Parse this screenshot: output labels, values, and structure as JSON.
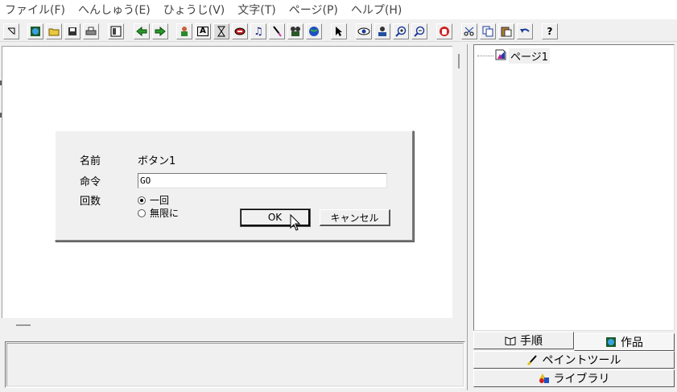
{
  "menu": [
    "ファイル(F)",
    "へんしゅう(E)",
    "ひょうじ(V)",
    "文字(T)",
    "ページ(P)",
    "ヘルプ(H)"
  ],
  "toolbar": {
    "help_label": "?",
    "text_tool_label": "A",
    "icons": [
      "select-arrow-icon",
      "new-page-icon",
      "open-folder-icon",
      "save-icon",
      "print-icon",
      "layout-icon",
      "back-arrow-icon",
      "forward-arrow-icon",
      "actor-icon",
      "text-tool-icon",
      "hourglass-icon",
      "button-tool-icon",
      "music-icon",
      "brush-icon",
      "movie-icon",
      "globe-icon",
      "pointer-icon",
      "eye-icon",
      "stamp-icon",
      "zoom-in-icon",
      "zoom-out-icon",
      "stop-hand-icon",
      "cut-icon",
      "copy-icon",
      "paste-icon",
      "undo-icon",
      "help-icon"
    ]
  },
  "dialog": {
    "name_label": "名前",
    "name_value": "ボタン1",
    "command_label": "命令",
    "command_value": "GO",
    "count_label": "回数",
    "radio_once": "一回",
    "radio_infinite": "無限に",
    "selected_radio": "once",
    "ok_label": "OK",
    "cancel_label": "キャンセル"
  },
  "tree": {
    "items": [
      {
        "label": "ページ1",
        "icon": "page-icon"
      }
    ]
  },
  "tabs": {
    "procedure": "手順",
    "works": "作品",
    "paint_tool": "ペイントツール",
    "library": "ライブラリ"
  },
  "colors": {
    "face": "#f0f0f0",
    "shadow": "#7a7a7a",
    "highlight": "#ffffff"
  }
}
